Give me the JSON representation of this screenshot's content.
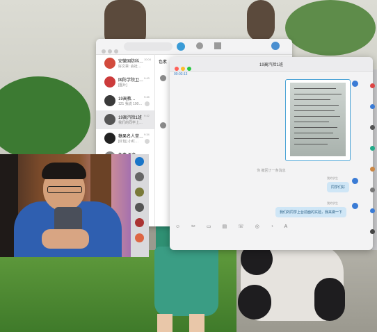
{
  "list_window": {
    "items": [
      {
        "name": "安徽国防科…",
        "msg": "好文章: 会社…",
        "time": "10:04",
        "avatar_color": "#d24b3d"
      },
      {
        "name": "国防学院卫…",
        "msg": "[图片]",
        "time": "9:43",
        "avatar_color": "#cc3b3b"
      },
      {
        "name": "19高教…",
        "msg": "121 我说 190…",
        "time": "9:45",
        "avatar_color": "#3a3a3a"
      },
      {
        "name": "19高汽检1班",
        "msg": "我们的同学上…",
        "time": "9:42",
        "avatar_color": "#555555",
        "selected": true
      },
      {
        "name": "糖果名人堂…",
        "msg": "[红包] 小红…",
        "time": "9:34",
        "avatar_color": "#222222"
      },
      {
        "name": "色素 不色…",
        "msg": "",
        "time": "",
        "avatar_color": "#888888"
      }
    ],
    "partial_label": "色素"
  },
  "chat_window": {
    "title": "19高汽检1班",
    "tab_label": "00:03:13",
    "system_message": "你 撤回了一条消息",
    "sender_nick_1": "我的学生",
    "bubble_1": "同学们好",
    "sender_nick_2": "我的学生",
    "bubble_2": "我们的同学上台前面的实验，我来做一下",
    "toolbar_icons": "☺ ✂ ▭ ▤ ☏ ◎ ◔ A"
  },
  "colors": {
    "accent": "#3a7bd5",
    "bubble": "#cfe6f6",
    "close": "#ff5f57",
    "minimize": "#febc2e",
    "zoom": "#28c840"
  }
}
